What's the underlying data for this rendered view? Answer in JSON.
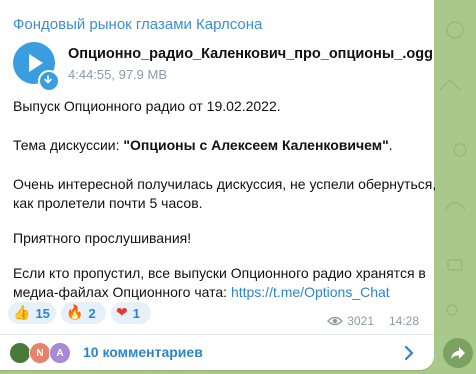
{
  "post": {
    "channel_name": "Фондовый рынок глазами Карлсона",
    "file": {
      "name": "Опционно_радио_Каленкович_про_опционы_.ogg",
      "meta": "4:44:55, 97.9 MB"
    },
    "lines": {
      "episode": "Выпуск Опционного радио от 19.02.2022.",
      "topic_prefix": "Тема дискуссии: ",
      "topic_bold": "\"Опционы с Алексеем Каленковичем\"",
      "topic_suffix": ".",
      "p1_line1": "Очень интересной получилась дискуссия, не успели обернуться,",
      "p1_line2": "как пролетели почти 5 часов.",
      "p2": "Приятного прослушивания!",
      "p3_line1": "Если кто пропустил, все выпуски Опционного радио хранятся в",
      "p3_line2_prefix": "медиа-файлах Опционного чата: ",
      "link": "https://t.me/Options_Chat"
    },
    "reactions": [
      {
        "emoji": "👍",
        "count": "15"
      },
      {
        "emoji": "🔥",
        "count": "2"
      },
      {
        "emoji": "❤",
        "count": "1"
      }
    ],
    "views": "3021",
    "time": "14:28",
    "comments": {
      "label": "10 комментариев",
      "avatars": [
        {
          "initial": "",
          "color": "#4a7a3a"
        },
        {
          "initial": "N",
          "color": "#e8806a"
        },
        {
          "initial": "A",
          "color": "#a68ad6"
        }
      ]
    }
  },
  "colors": {
    "accent": "#2c84d0",
    "background": "#a9c98a"
  }
}
